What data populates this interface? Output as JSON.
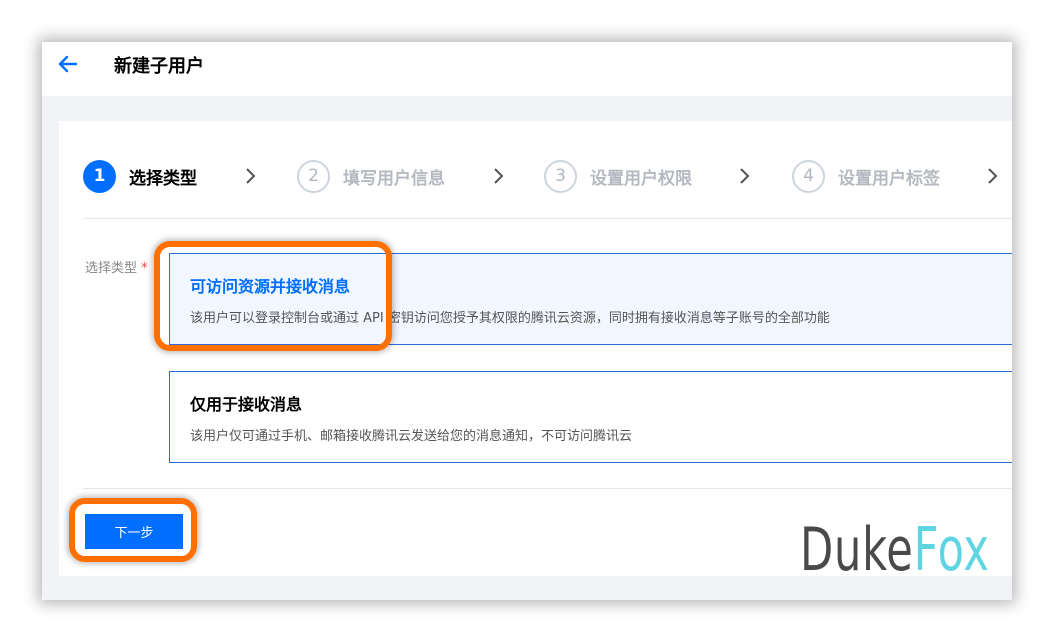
{
  "header": {
    "title": "新建子用户"
  },
  "steps": [
    {
      "number": "1",
      "label": "选择类型",
      "active": true
    },
    {
      "number": "2",
      "label": "填写用户信息",
      "active": false
    },
    {
      "number": "3",
      "label": "设置用户权限",
      "active": false
    },
    {
      "number": "4",
      "label": "设置用户标签",
      "active": false
    }
  ],
  "form": {
    "type_label": "选择类型",
    "required_mark": "*"
  },
  "options": [
    {
      "title": "可访问资源并接收消息",
      "description": "该用户可以登录控制台或通过 API 密钥访问您授予其权限的腾讯云资源，同时拥有接收消息等子账号的全部功能",
      "selected": true
    },
    {
      "title": "仅用于接收消息",
      "description": "该用户仅可通过手机、邮箱接收腾讯云发送给您的消息通知，不可访问腾讯云",
      "selected": false
    }
  ],
  "actions": {
    "next_label": "下一步"
  },
  "watermark": {
    "part1": "Duke",
    "part2": "Fox"
  },
  "colors": {
    "primary": "#006eff",
    "highlight": "#ff7000",
    "option_border": "#2e6fd6",
    "selected_bg": "#f2f6ff"
  }
}
